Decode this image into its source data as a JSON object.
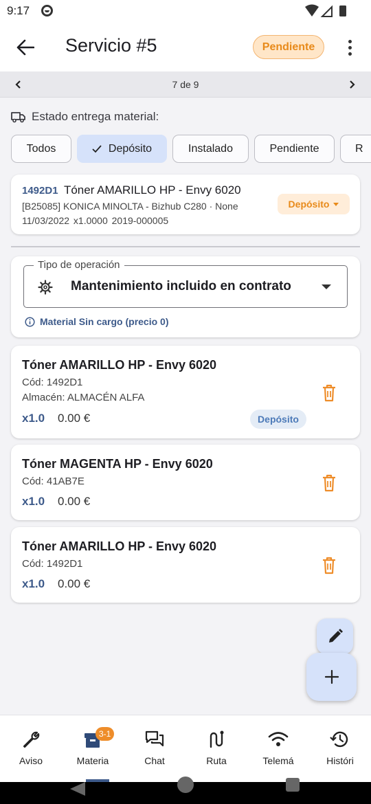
{
  "status_bar": {
    "time": "9:17"
  },
  "header": {
    "title": "Servicio #5",
    "status": "Pendiente"
  },
  "pager": {
    "label": "7 de 9"
  },
  "estado": {
    "label": "Estado entrega material:",
    "filters": [
      {
        "label": "Todos",
        "selected": false
      },
      {
        "label": "Depósito",
        "selected": true
      },
      {
        "label": "Instalado",
        "selected": false
      },
      {
        "label": "Pendiente",
        "selected": false
      },
      {
        "label": "R",
        "selected": false
      }
    ]
  },
  "summary": {
    "code": "1492D1",
    "title": "Tóner AMARILLO HP - Envy 6020",
    "line2": "[B25085] KONICA MINOLTA - Bizhub C280 · None",
    "line3": "11/03/2022  x1.0000  2019-000005",
    "state": "Depósito"
  },
  "operation": {
    "legend": "Tipo de operación",
    "value": "Mantenimiento incluido en contrato",
    "info": "Material Sin cargo (precio 0)"
  },
  "materials": [
    {
      "title": "Tóner AMARILLO HP - Envy 6020",
      "code": "Cód: 1492D1",
      "almacen": "Almacén: ALMACÉN ALFA",
      "qty": "x1.0",
      "price": "0.00 €",
      "badge": "Depósito"
    },
    {
      "title": "Tóner MAGENTA HP - Envy 6020",
      "code": "Cód: 41AB7E",
      "qty": "x1.0",
      "price": "0.00 €"
    },
    {
      "title": "Tóner AMARILLO HP - Envy 6020",
      "code": "Cód: 1492D1",
      "qty": "x1.0",
      "price": "0.00 €"
    }
  ],
  "bottom_nav": [
    {
      "label": "Aviso",
      "icon": "wrench-icon"
    },
    {
      "label": "Materia",
      "icon": "box-icon",
      "badge": "3-1"
    },
    {
      "label": "Chat",
      "icon": "chat-icon"
    },
    {
      "label": "Ruta",
      "icon": "route-icon"
    },
    {
      "label": "Telemá",
      "icon": "wifi-icon"
    },
    {
      "label": "Históri",
      "icon": "history-icon"
    }
  ],
  "colors": {
    "accent": "#3d5a8a",
    "warning": "#e88a1a",
    "chip_selected": "#d6e2fa"
  }
}
